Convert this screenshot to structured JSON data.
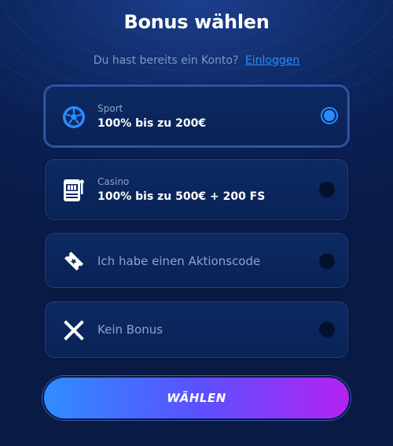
{
  "header": {
    "title": "Bonus wählen",
    "login_prompt": "Du hast bereits ein Konto?",
    "login_link": "Einloggen"
  },
  "options": [
    {
      "category": "Sport",
      "label": "100% bis zu 200€",
      "icon": "soccer-ball-icon",
      "selected": true
    },
    {
      "category": "Casino",
      "label": "100% bis zu 500€ + 200 FS",
      "icon": "slot-machine-icon",
      "selected": false
    },
    {
      "label": "Ich habe einen Aktionscode",
      "icon": "ticket-icon",
      "selected": false
    },
    {
      "label": "Kein Bonus",
      "icon": "close-icon",
      "selected": false
    }
  ],
  "cta": {
    "label": "WÄHLEN"
  },
  "colors": {
    "accent": "#2a8cff",
    "cta_start": "#2f8dff",
    "cta_end": "#b422f2",
    "background": "#0a1f52"
  }
}
